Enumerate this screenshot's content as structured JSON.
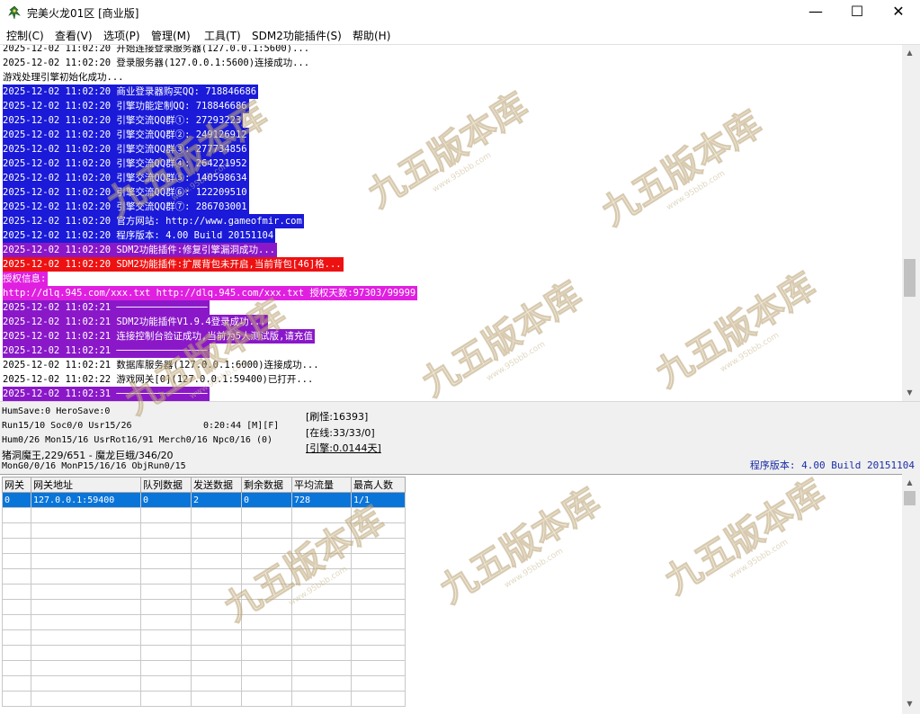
{
  "window": {
    "title": "完美火龙01区 [商业版]",
    "buttons": {
      "minimize": "—",
      "maximize": "☐",
      "close": "✕"
    }
  },
  "menu": [
    "控制(C)",
    "查看(V)",
    "选项(P)",
    "管理(M)",
    "工具(T)",
    "SDM2功能插件(S)",
    "帮助(H)"
  ],
  "log": [
    {
      "text": "2025-12-02 11:02:20 开始连接登录服务器(127.0.0.1:5600)...",
      "bg": "#ffffff",
      "fg": "#000000"
    },
    {
      "text": "2025-12-02 11:02:20 登录服务器(127.0.0.1:5600)连接成功...",
      "bg": "#ffffff",
      "fg": "#000000"
    },
    {
      "text": "游戏处理引擎初始化成功...",
      "bg": "#ffffff",
      "fg": "#000000"
    },
    {
      "text": "2025-12-02 11:02:20 商业登录器购买QQ: 718846686",
      "bg": "#1a1ad8",
      "fg": "#ffffff"
    },
    {
      "text": "2025-12-02 11:02:20 引擎功能定制QQ: 718846686",
      "bg": "#1a1ad8",
      "fg": "#ffffff"
    },
    {
      "text": "2025-12-02 11:02:20 引擎交流QQ群①: 27293223",
      "bg": "#1a1ad8",
      "fg": "#ffffff"
    },
    {
      "text": "2025-12-02 11:02:20 引擎交流QQ群②: 249126912",
      "bg": "#1a1ad8",
      "fg": "#ffffff"
    },
    {
      "text": "2025-12-02 11:02:20 引擎交流QQ群③: 277734856",
      "bg": "#1a1ad8",
      "fg": "#ffffff"
    },
    {
      "text": "2025-12-02 11:02:20 引擎交流QQ群④: 264221952",
      "bg": "#1a1ad8",
      "fg": "#ffffff"
    },
    {
      "text": "2025-12-02 11:02:20 引擎交流QQ群⑤: 140598634",
      "bg": "#1a1ad8",
      "fg": "#ffffff"
    },
    {
      "text": "2025-12-02 11:02:20 引擎交流QQ群⑥: 122209510",
      "bg": "#1a1ad8",
      "fg": "#ffffff"
    },
    {
      "text": "2025-12-02 11:02:20 引擎交流QQ群⑦: 286703001",
      "bg": "#1a1ad8",
      "fg": "#ffffff"
    },
    {
      "text": "2025-12-02 11:02:20 官方网站: http://www.gameofmir.com",
      "bg": "#1a1ad8",
      "fg": "#ffffff"
    },
    {
      "text": "2025-12-02 11:02:20 程序版本: 4.00 Build 20151104",
      "bg": "#1a1ad8",
      "fg": "#ffffff"
    },
    {
      "text": "2025-12-02 11:02:20 SDM2功能插件:修复引擎漏洞成功...",
      "bg": "#8a18c8",
      "fg": "#ffffff"
    },
    {
      "text": "2025-12-02 11:02:20 SDM2功能插件:扩展背包未开启,当前背包[46]格...",
      "bg": "#ee1111",
      "fg": "#ffffff"
    },
    {
      "text": "授权信息:",
      "bg": "#e020e0",
      "fg": "#ffffff"
    },
    {
      "text": "http://dlq.945.com/xxx.txt http://dlq.945.com/xxx.txt 授权天数:97303/99999",
      "bg": "#e020e0",
      "fg": "#ffffff"
    },
    {
      "text": "2025-12-02 11:02:21 ────────────────",
      "bg": "#8a18c8",
      "fg": "#ffffff"
    },
    {
      "text": "2025-12-02 11:02:21 SDM2功能插件V1.9.4登录成功...",
      "bg": "#8a18c8",
      "fg": "#ffffff"
    },
    {
      "text": "2025-12-02 11:02:21 连接控制台验证成功,当前为5人测试版,请充值",
      "bg": "#8a18c8",
      "fg": "#ffffff"
    },
    {
      "text": "2025-12-02 11:02:21 ────────────────",
      "bg": "#8a18c8",
      "fg": "#ffffff"
    },
    {
      "text": "2025-12-02 11:02:21 数据库服务器(127.0.0.1:6000)连接成功...",
      "bg": "#ffffff",
      "fg": "#000000"
    },
    {
      "text": "2025-12-02 11:02:22 游戏网关[0](127.0.0.1:59400)已打开...",
      "bg": "#ffffff",
      "fg": "#000000"
    },
    {
      "text": "2025-12-02 11:02:31 ────────────────",
      "bg": "#8a18c8",
      "fg": "#ffffff"
    }
  ],
  "status": {
    "line1": "HumSave:0 HeroSave:0",
    "line2a": "Run15/10 Soc0/0 Usr15/26",
    "line2b": "0:20:44 [M][F]",
    "line3": "Hum0/26 Mon15/16 UsrRot16/91 Merch0/16 Npc0/16 (0)",
    "line4": "猪洞魔王,229/651 - 魔龙巨蛾/346/20",
    "line5": "MonG0/0/16 MonP15/16/16 ObjRun0/15",
    "side1": "[刷怪:16393]",
    "side2": "[在线:33/33/0]",
    "side3": "[引擎:0.0144天]",
    "version": "程序版本: 4.00 Build 20151104"
  },
  "gateway_table": {
    "headers": [
      "网关",
      "网关地址",
      "队列数据",
      "发送数据",
      "剩余数据",
      "平均流量",
      "最高人数"
    ],
    "rows": [
      [
        "0",
        "127.0.0.1:59400",
        "0",
        "2",
        "0",
        "728",
        "1/1"
      ]
    ]
  },
  "watermark_text": "九五版本库"
}
